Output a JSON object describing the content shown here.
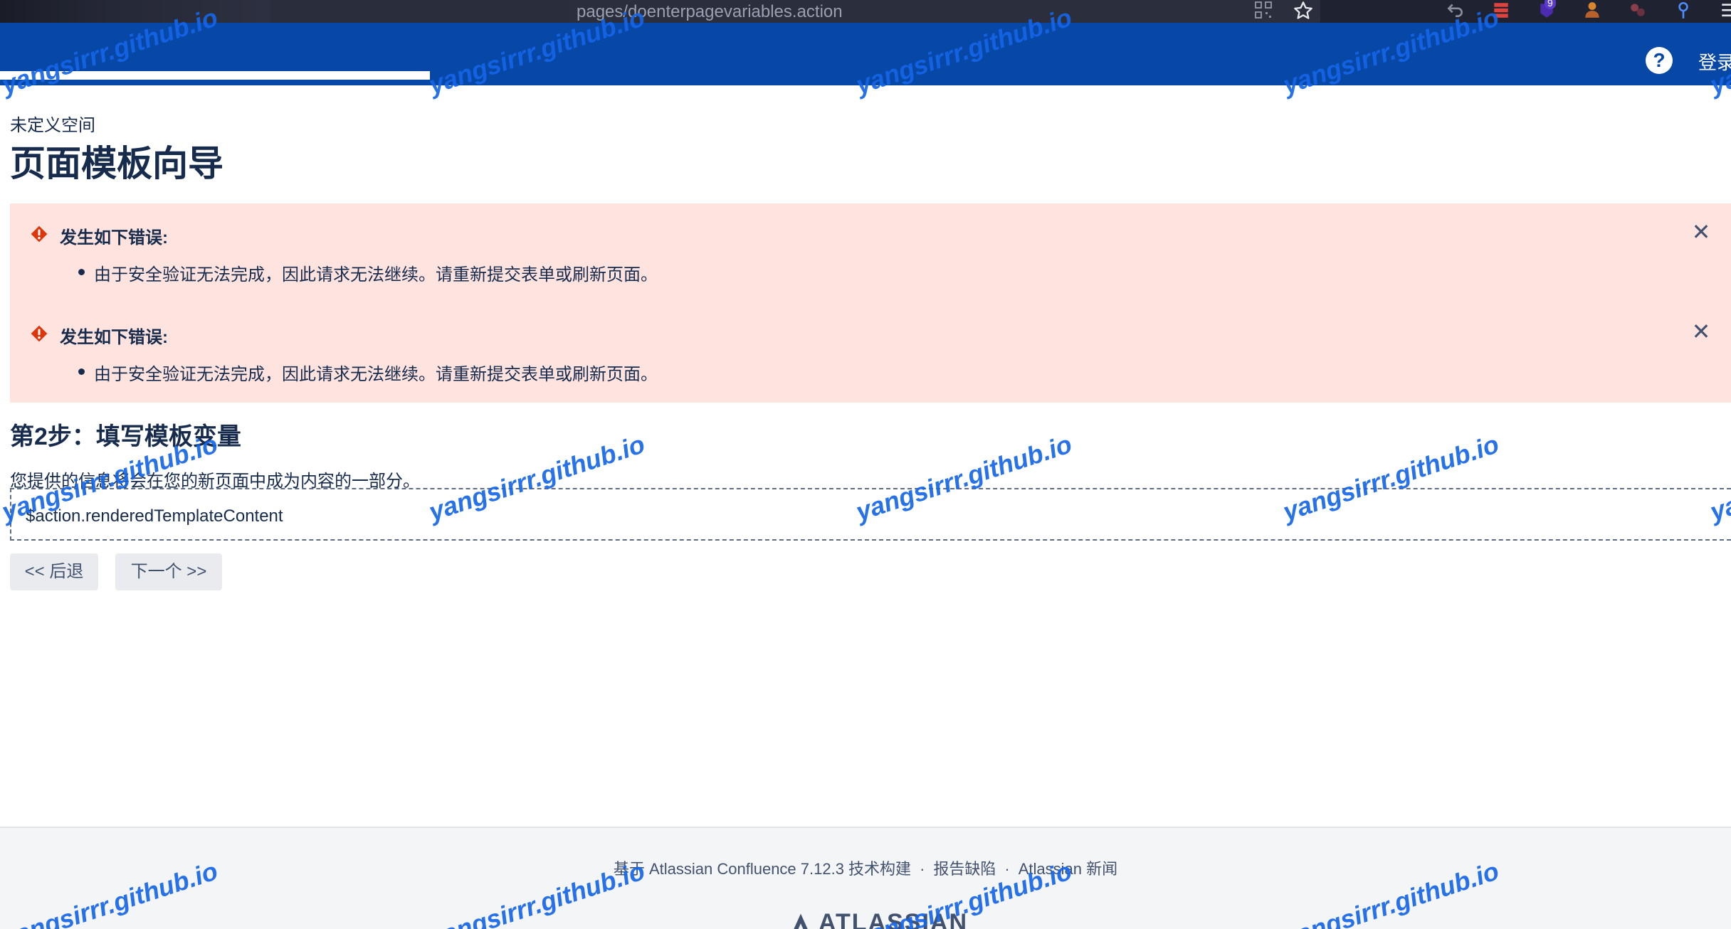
{
  "browser": {
    "url": "pages/doenterpagevariables.action",
    "icons": [
      "qr-code-icon",
      "star-icon",
      "undo-icon",
      "extension-red-icon",
      "extension-badge-icon",
      "extension-user-icon",
      "extension-dots-icon",
      "pin-icon",
      "menu-icon"
    ],
    "badge_count": "9"
  },
  "header": {
    "help_label": "?",
    "login_label": "登录"
  },
  "page": {
    "space_name": "未定义空间",
    "title": "页面模板向导"
  },
  "errors": [
    {
      "title": "发生如下错误:",
      "item": "由于安全验证无法完成，因此请求无法继续。请重新提交表单或刷新页面。",
      "close": "✕"
    },
    {
      "title": "发生如下错误:",
      "item": "由于安全验证无法完成，因此请求无法继续。请重新提交表单或刷新页面。",
      "close": "✕"
    }
  ],
  "step": {
    "title": "第2步：填写模板变量",
    "description": "您提供的信息将会在您的新页面中成为内容的一部分。",
    "template_content": "$action.renderedTemplateContent"
  },
  "buttons": {
    "back": "<< 后退",
    "next": "下一个 >>"
  },
  "footer": {
    "powered_by": "基于 Atlassian Confluence 7.12.3 技术构建",
    "report_bug": "报告缺陷",
    "news": "Atlassian 新闻",
    "separator": "·",
    "logo_text": "ATLASSIAN"
  },
  "watermark": {
    "text": "yangsirrr.github.io"
  },
  "colors": {
    "header": "#0747a6",
    "error_bg": "#ffe3df",
    "error_icon": "#de350b",
    "watermark": "#1565e8"
  }
}
